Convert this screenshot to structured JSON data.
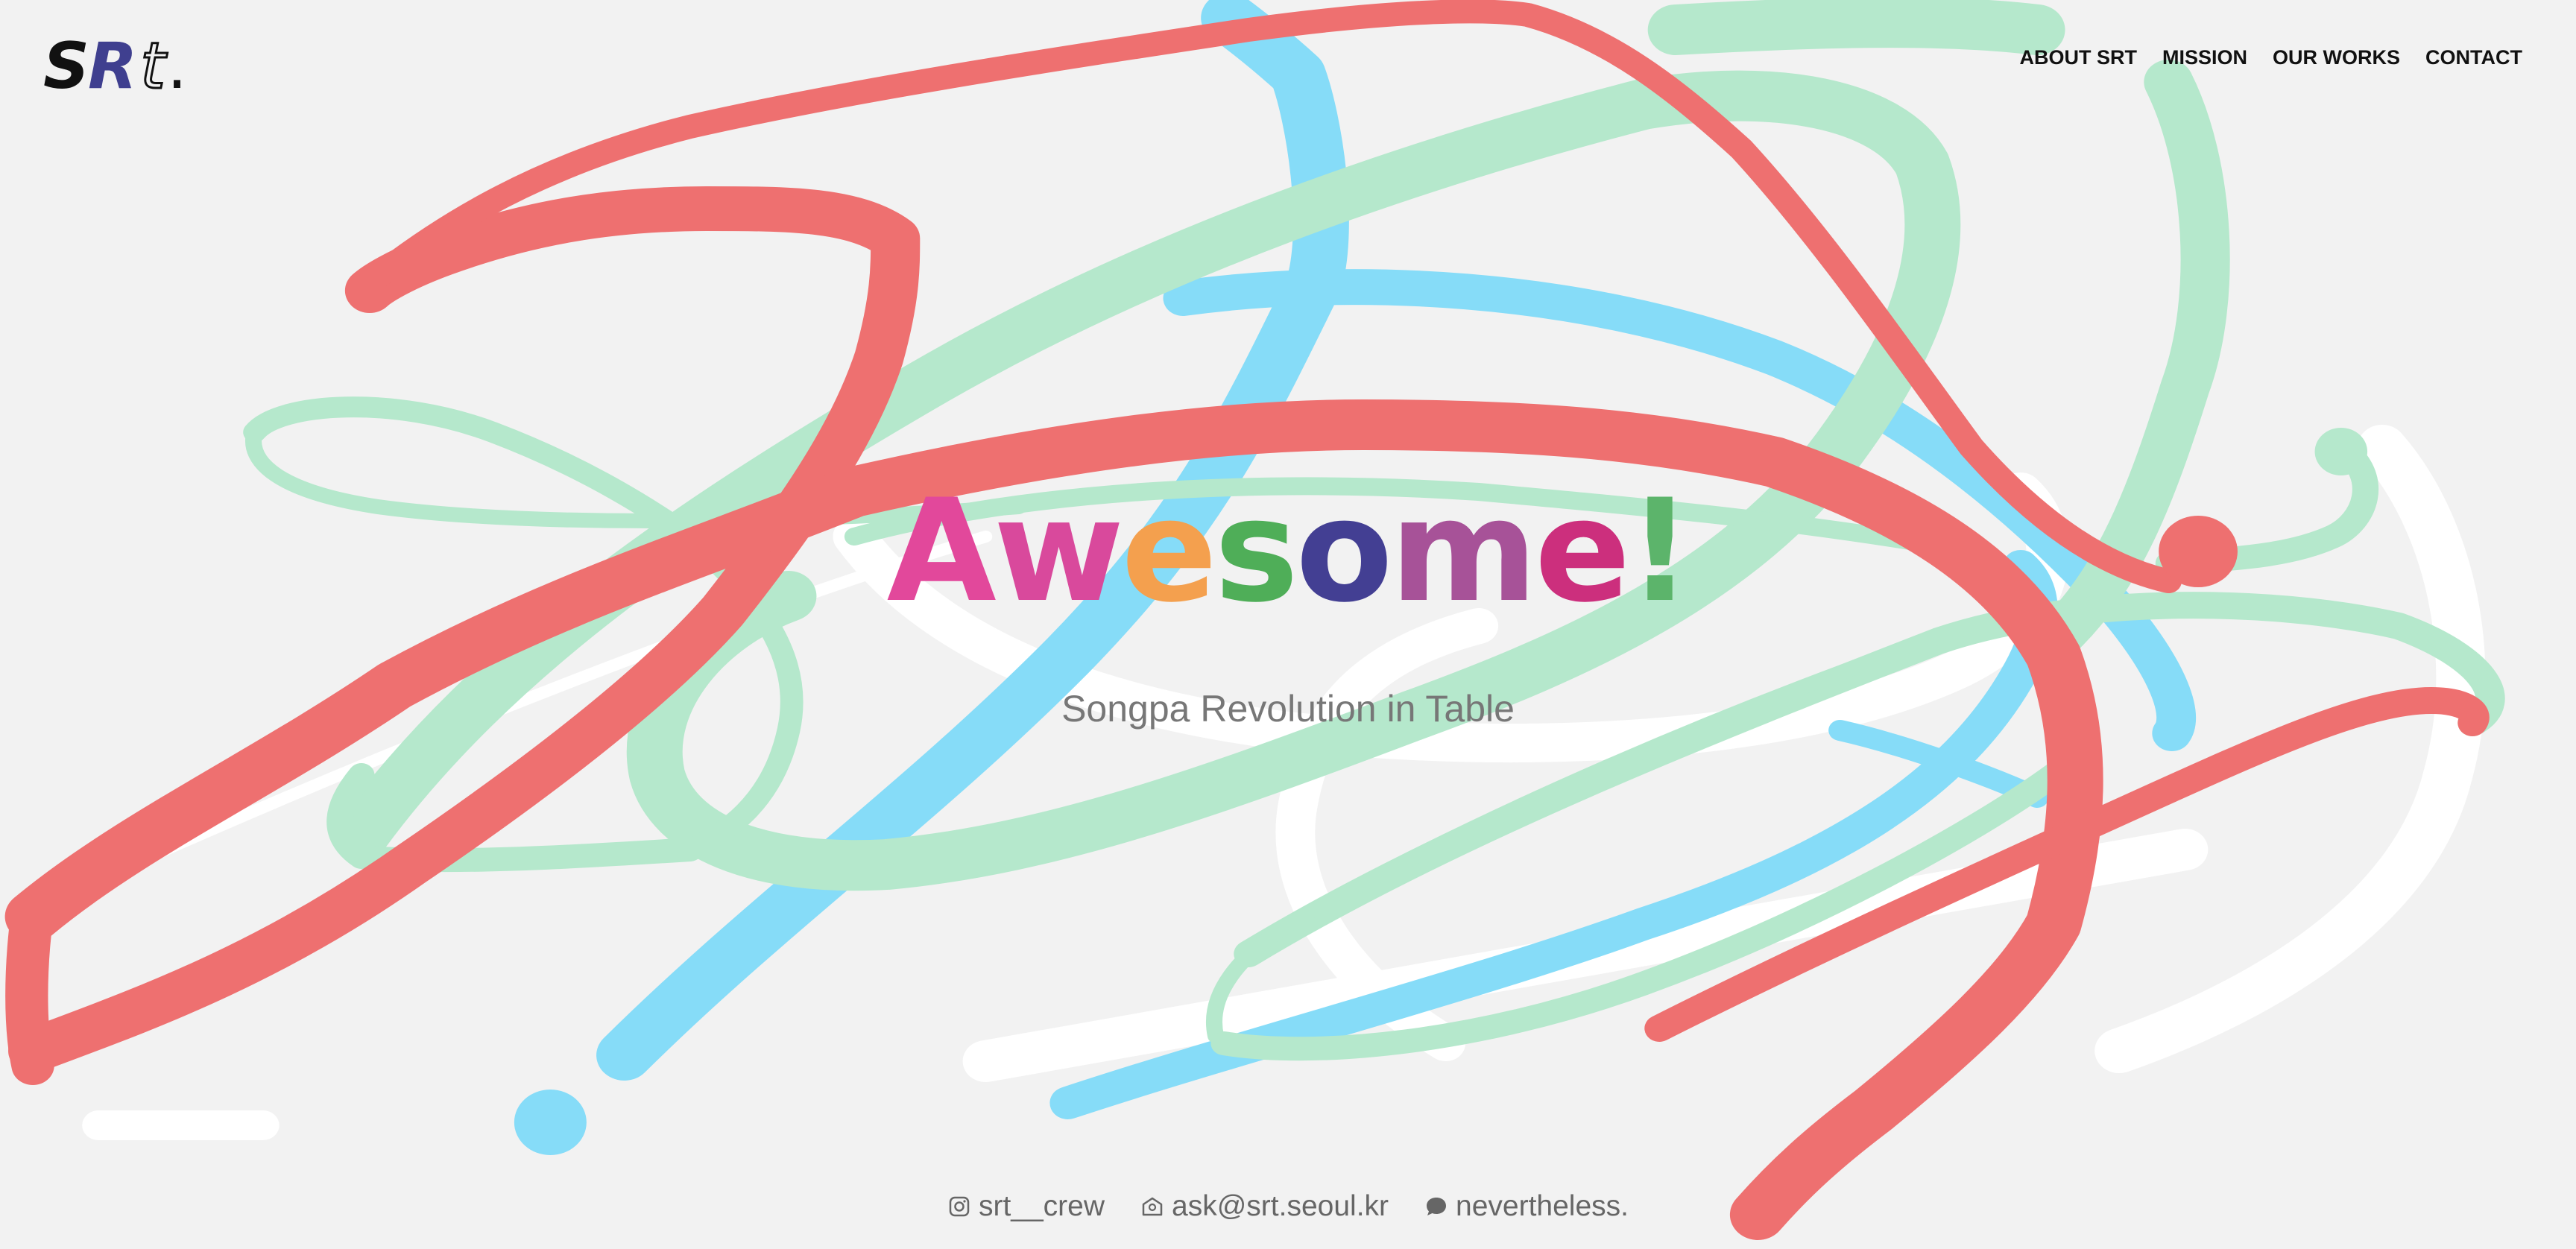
{
  "logo": {
    "part1": "S",
    "part2": "R",
    "part3": "t",
    "part4": "."
  },
  "nav": {
    "about": "ABOUT SRT",
    "mission": "MISSION",
    "works": "OUR WORKS",
    "contact": "CONTACT"
  },
  "hero": {
    "letters": [
      "A",
      "w",
      "e",
      "s",
      "o",
      "m",
      "e",
      "!"
    ],
    "colors": [
      "#e2489b",
      "#d9499c",
      "#f4a04e",
      "#4fae58",
      "#433f93",
      "#a75298",
      "#cc2f7d",
      "#5cb46b"
    ]
  },
  "subtitle": "Songpa Revolution in Table",
  "footer": {
    "instagram": "srt__crew",
    "email": "ask@srt.seoul.kr",
    "chat": "nevertheless."
  },
  "colors": {
    "red": "#ee7070",
    "mint": "#b5e8cc",
    "blue": "#86dcf8",
    "white": "#ffffff",
    "background": "#f2f2f2"
  }
}
